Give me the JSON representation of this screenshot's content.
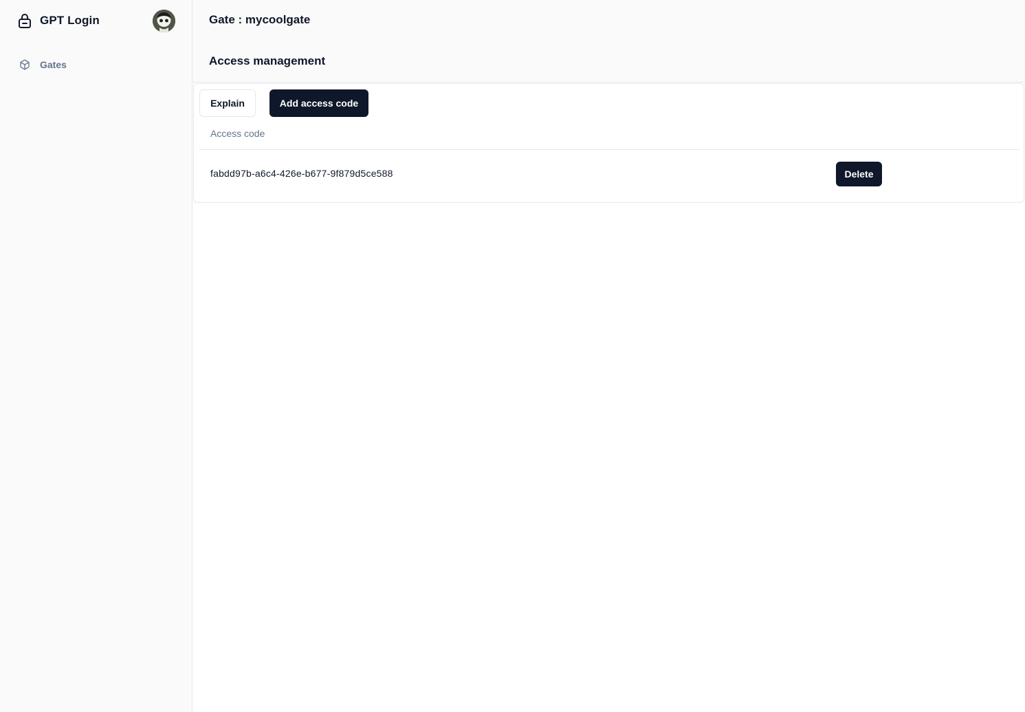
{
  "sidebar": {
    "brand": {
      "icon": "lock-icon",
      "name": "GPT Login"
    },
    "avatar": {
      "icon": "user-avatar"
    },
    "items": [
      {
        "icon": "box-icon",
        "label": "Gates"
      }
    ]
  },
  "main": {
    "title": "Gate : mycoolgate",
    "section_title": "Access management",
    "toolbar": {
      "explain_label": "Explain",
      "add_label": "Add access code"
    },
    "table": {
      "columns": [
        "Access code"
      ],
      "rows": [
        {
          "code": "fabdd97b-a6c4-426e-b677-9f879d5ce588",
          "action_label": "Delete"
        }
      ]
    }
  },
  "colors": {
    "primary": "#0f172a",
    "muted_text": "#64748b",
    "border": "#e5e7eb",
    "sidebar_bg": "#fafafa"
  }
}
